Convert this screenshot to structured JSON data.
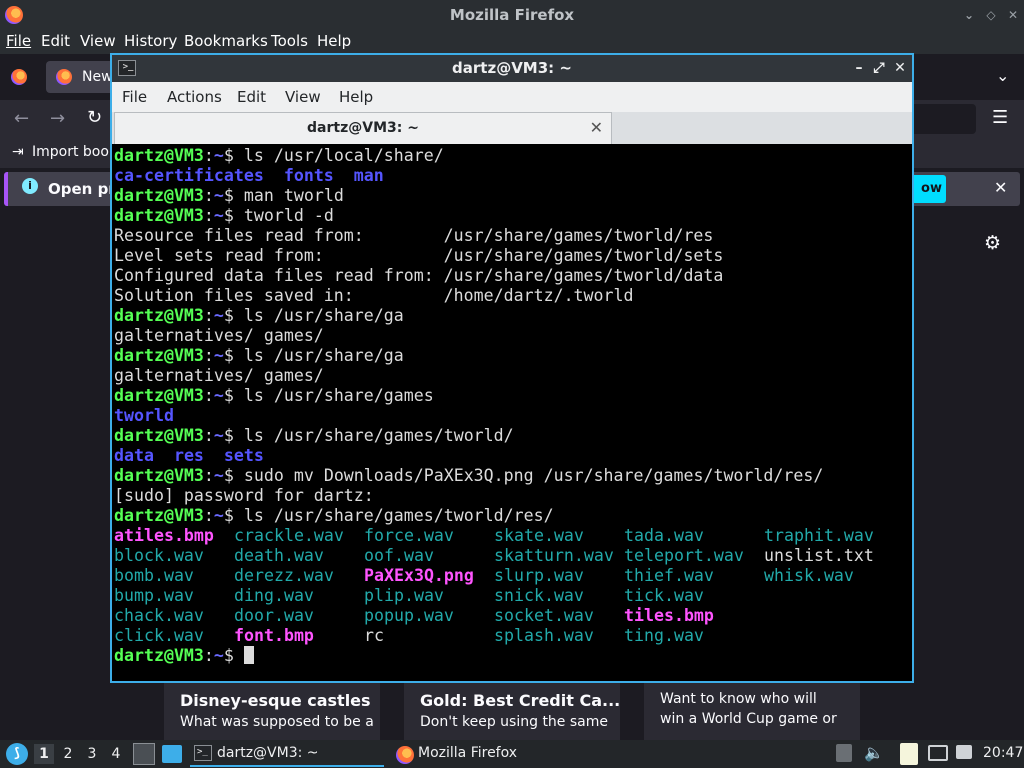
{
  "firefox": {
    "window_title": "Mozilla Firefox",
    "menu": [
      "File",
      "Edit",
      "View",
      "History",
      "Bookmarks",
      "Tools",
      "Help"
    ],
    "tab_label": "New",
    "bookmarks_label": "Import book",
    "info_text": "Open pre",
    "info_button": "ow",
    "cards": [
      {
        "title": "Disney-esque castles",
        "desc": "What was supposed to be a"
      },
      {
        "title": "Gold: Best Credit Ca...",
        "desc": "Don't keep using the same"
      },
      {
        "title": "",
        "desc": "Want to know who will win a World Cup game or"
      }
    ]
  },
  "terminal": {
    "window_title": "dartz@VM3: ~",
    "menu": [
      "File",
      "Actions",
      "Edit",
      "View",
      "Help"
    ],
    "tab_label": "dartz@VM3: ~",
    "prompt_user": "dartz@VM3",
    "prompt_sep": ":",
    "prompt_path": "~",
    "prompt_dollar": "$ ",
    "lines": [
      {
        "type": "cmd",
        "text": "ls /usr/local/share/"
      },
      {
        "type": "dirs",
        "items": [
          "ca-certificates",
          "fonts",
          "man"
        ]
      },
      {
        "type": "cmd",
        "text": "man tworld"
      },
      {
        "type": "cmd",
        "text": "tworld -d"
      },
      {
        "type": "out",
        "text": "Resource files read from:        /usr/share/games/tworld/res"
      },
      {
        "type": "out",
        "text": "Level sets read from:            /usr/share/games/tworld/sets"
      },
      {
        "type": "out",
        "text": "Configured data files read from: /usr/share/games/tworld/data"
      },
      {
        "type": "out",
        "text": "Solution files saved in:         /home/dartz/.tworld"
      },
      {
        "type": "cmd",
        "text": "ls /usr/share/ga"
      },
      {
        "type": "out",
        "text": "galternatives/ games/"
      },
      {
        "type": "cmd",
        "text": "ls /usr/share/ga"
      },
      {
        "type": "out",
        "text": "galternatives/ games/"
      },
      {
        "type": "cmd",
        "text": "ls /usr/share/games"
      },
      {
        "type": "dirs",
        "items": [
          "tworld"
        ]
      },
      {
        "type": "cmd",
        "text": "ls /usr/share/games/tworld/"
      },
      {
        "type": "dirs",
        "items": [
          "data",
          "res",
          "sets"
        ]
      },
      {
        "type": "cmd",
        "text": "sudo mv Downloads/PaXEx3Q.png /usr/share/games/tworld/res/"
      },
      {
        "type": "out",
        "text": "[sudo] password for dartz:"
      },
      {
        "type": "cmd",
        "text": "ls /usr/share/games/tworld/res/"
      }
    ],
    "listing": [
      [
        {
          "n": "atiles.bmp",
          "c": "mag"
        },
        {
          "n": "crackle.wav",
          "c": "cyan"
        },
        {
          "n": "force.wav",
          "c": "cyan"
        },
        {
          "n": "skate.wav",
          "c": "cyan"
        },
        {
          "n": "tada.wav",
          "c": "cyan"
        },
        {
          "n": "traphit.wav",
          "c": "cyan"
        }
      ],
      [
        {
          "n": "block.wav",
          "c": "cyan"
        },
        {
          "n": "death.wav",
          "c": "cyan"
        },
        {
          "n": "oof.wav",
          "c": "cyan"
        },
        {
          "n": "skatturn.wav",
          "c": "cyan"
        },
        {
          "n": "teleport.wav",
          "c": "cyan"
        },
        {
          "n": "unslist.txt",
          "c": "plain"
        }
      ],
      [
        {
          "n": "bomb.wav",
          "c": "cyan"
        },
        {
          "n": "derezz.wav",
          "c": "cyan"
        },
        {
          "n": "PaXEx3Q.png",
          "c": "mag"
        },
        {
          "n": "slurp.wav",
          "c": "cyan"
        },
        {
          "n": "thief.wav",
          "c": "cyan"
        },
        {
          "n": "whisk.wav",
          "c": "cyan"
        }
      ],
      [
        {
          "n": "bump.wav",
          "c": "cyan"
        },
        {
          "n": "ding.wav",
          "c": "cyan"
        },
        {
          "n": "plip.wav",
          "c": "cyan"
        },
        {
          "n": "snick.wav",
          "c": "cyan"
        },
        {
          "n": "tick.wav",
          "c": "cyan"
        }
      ],
      [
        {
          "n": "chack.wav",
          "c": "cyan"
        },
        {
          "n": "door.wav",
          "c": "cyan"
        },
        {
          "n": "popup.wav",
          "c": "cyan"
        },
        {
          "n": "socket.wav",
          "c": "cyan"
        },
        {
          "n": "tiles.bmp",
          "c": "mag"
        }
      ],
      [
        {
          "n": "click.wav",
          "c": "cyan"
        },
        {
          "n": "font.bmp",
          "c": "mag"
        },
        {
          "n": "rc",
          "c": "plain"
        },
        {
          "n": "splash.wav",
          "c": "cyan"
        },
        {
          "n": "ting.wav",
          "c": "cyan"
        }
      ]
    ]
  },
  "taskbar": {
    "desktops": [
      "1",
      "2",
      "3",
      "4"
    ],
    "terminal_task": "dartz@VM3: ~",
    "firefox_task": "Mozilla Firefox",
    "clock": "20:47"
  }
}
